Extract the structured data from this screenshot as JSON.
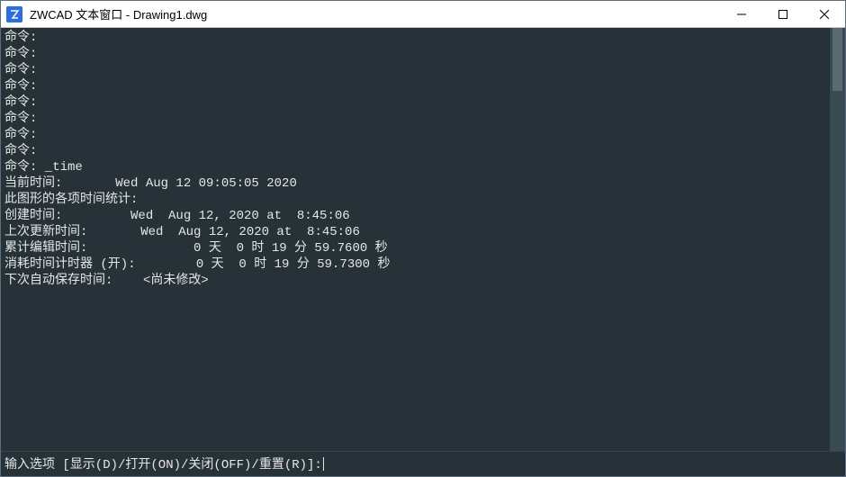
{
  "titlebar": {
    "title": "ZWCAD 文本窗口 - Drawing1.dwg"
  },
  "console": {
    "lines": [
      "命令:",
      "命令:",
      "命令:",
      "命令:",
      "命令:",
      "命令:",
      "命令:",
      "命令:",
      "命令: _time",
      "当前时间:       Wed Aug 12 09:05:05 2020",
      "此图形的各项时间统计:",
      "创建时间:         Wed  Aug 12, 2020 at  8:45:06",
      "上次更新时间:       Wed  Aug 12, 2020 at  8:45:06",
      "累计编辑时间:              0 天  0 时 19 分 59.7600 秒",
      "消耗时间计时器 (开):        0 天  0 时 19 分 59.7300 秒",
      "下次自动保存时间:    <尚未修改>"
    ]
  },
  "prompt": {
    "label": "输入选项 [显示(D)/打开(ON)/关闭(OFF)/重置(R)]:",
    "value": ""
  }
}
